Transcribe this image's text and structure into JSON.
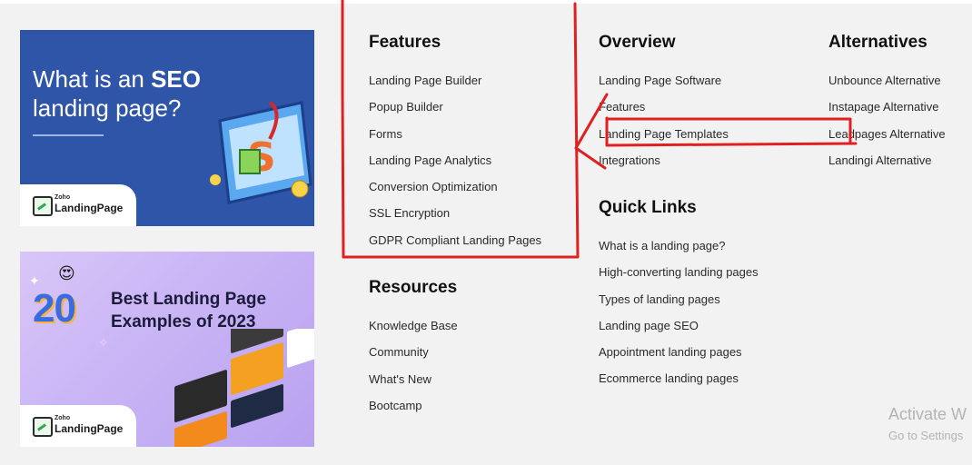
{
  "promo_cards": [
    {
      "title_prefix": "What is an ",
      "title_bold": "SEO",
      "title_suffix": "landing page?",
      "logo_small": "Zoho",
      "logo_main": "LandingPage"
    },
    {
      "number": "20",
      "title": "Best Landing Page Examples of 2023",
      "logo_small": "Zoho",
      "logo_main": "LandingPage"
    }
  ],
  "features": {
    "heading": "Features",
    "items": [
      "Landing Page Builder",
      "Popup Builder",
      "Forms",
      "Landing Page Analytics",
      "Conversion Optimization",
      "SSL Encryption",
      "GDPR Compliant Landing Pages"
    ]
  },
  "resources": {
    "heading": "Resources",
    "items": [
      "Knowledge Base",
      "Community",
      "What's New",
      "Bootcamp"
    ]
  },
  "overview": {
    "heading": "Overview",
    "items": [
      "Landing Page Software",
      "Features",
      "Landing Page Templates",
      "Integrations"
    ]
  },
  "quick_links": {
    "heading": "Quick Links",
    "items": [
      "What is a landing page?",
      "High-converting landing pages",
      "Types of landing pages",
      "Landing page SEO",
      "Appointment landing pages",
      "Ecommerce landing pages"
    ]
  },
  "alternatives": {
    "heading": "Alternatives",
    "items": [
      "Unbounce Alternative",
      "Instapage Alternative",
      "Leadpages Alternative",
      "Landingi Alternative"
    ]
  },
  "watermark": {
    "line1": "Activate W",
    "line2": "Go to Settings"
  },
  "colors": {
    "background": "#f2f2f2",
    "annotation": "#e02020",
    "card1": "#2f55a8"
  }
}
